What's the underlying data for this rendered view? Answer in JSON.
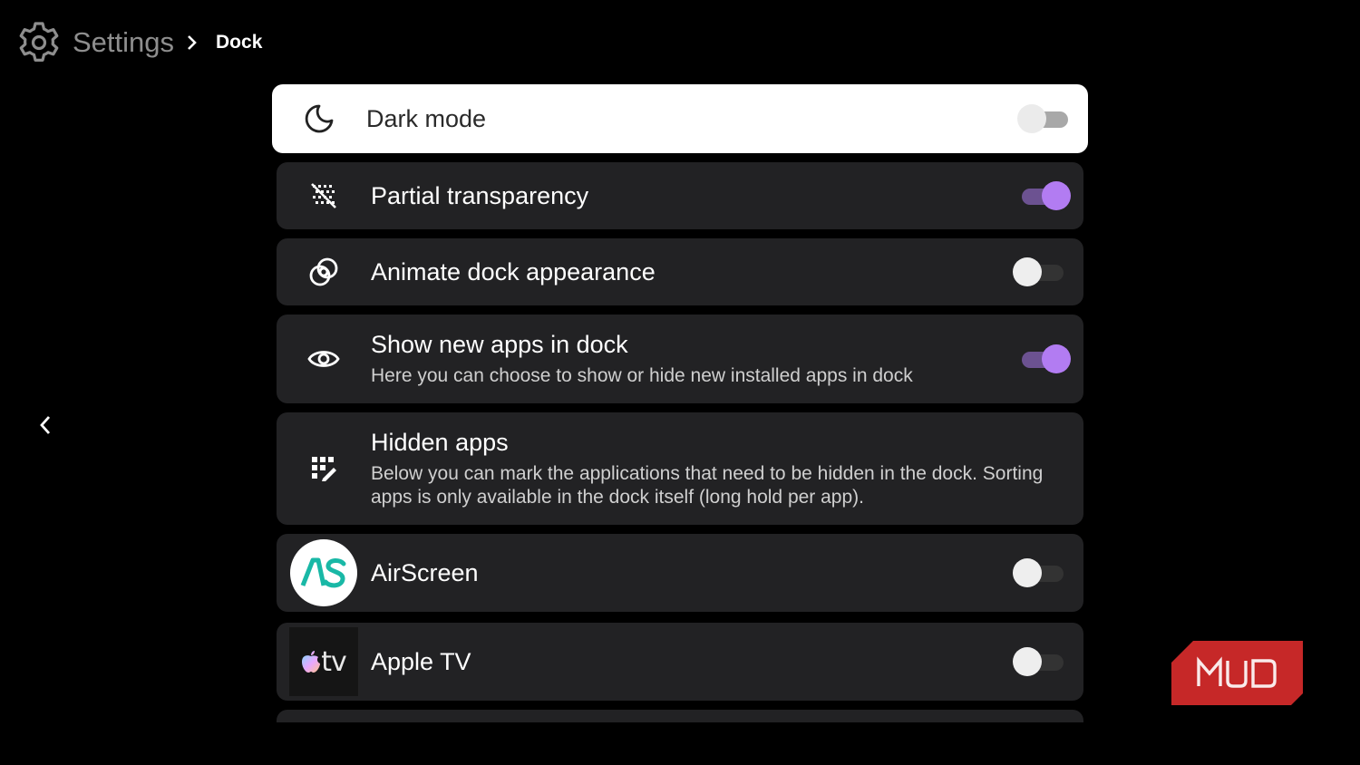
{
  "header": {
    "settings_label": "Settings",
    "breadcrumb_current": "Dock"
  },
  "rows": [
    {
      "title": "Dark mode",
      "icon": "moon-icon",
      "toggle": "off",
      "focused": true
    },
    {
      "title": "Partial transparency",
      "icon": "transparency-icon",
      "toggle": "on"
    },
    {
      "title": "Animate dock appearance",
      "icon": "animate-icon",
      "toggle": "off"
    },
    {
      "title": "Show new apps in dock",
      "description": "Here you can choose to show or hide new installed apps in dock",
      "icon": "eye-icon",
      "toggle": "on"
    },
    {
      "title": "Hidden apps",
      "description": "Below you can mark the applications that need to be hidden in the dock. Sorting apps is only available in the dock itself (long hold per app).",
      "icon": "hidden-apps-icon"
    },
    {
      "title": "AirScreen",
      "icon": "airscreen-app-icon",
      "icon_text": "AS",
      "toggle": "off"
    },
    {
      "title": "Apple TV",
      "icon": "apple-tv-app-icon",
      "icon_text": "tv",
      "toggle": "off"
    }
  ],
  "watermark": {
    "text": "MUO"
  },
  "colors": {
    "background": "#000000",
    "card": "#222224",
    "accent": "#b27cf2",
    "airscreen": "#19b8a6",
    "watermark": "#d32f2f"
  }
}
